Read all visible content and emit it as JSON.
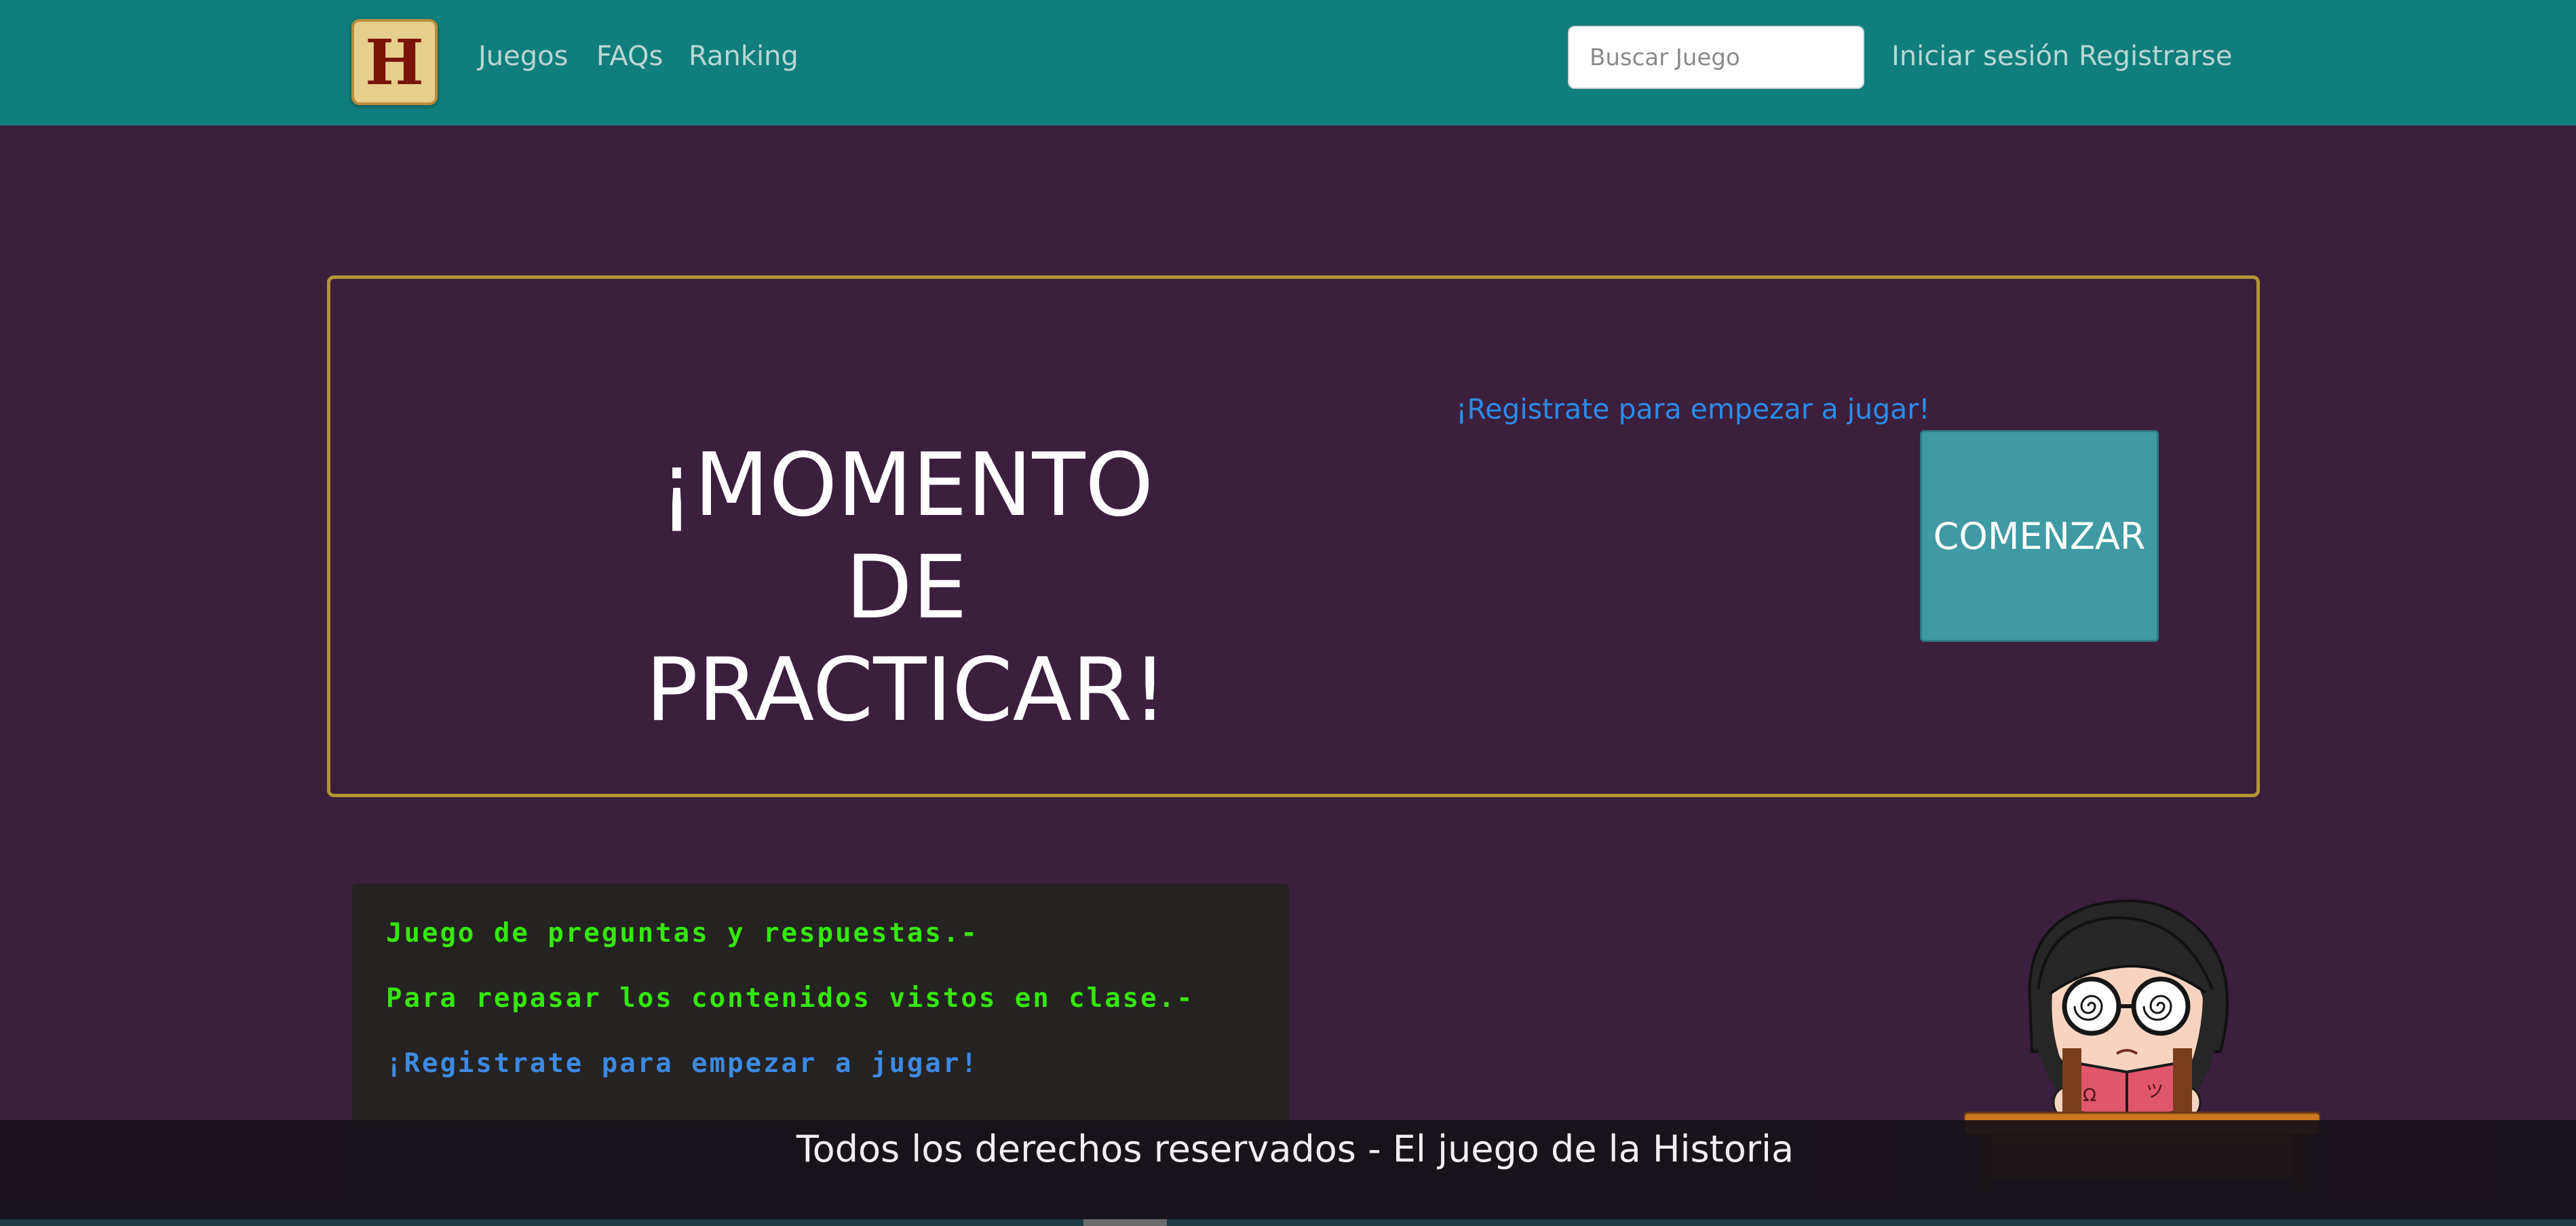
{
  "nav": {
    "logo_letter": "H",
    "links": [
      "Juegos",
      "FAQs",
      "Ranking"
    ],
    "search_placeholder": "Buscar Juego",
    "login": "Iniciar sesión",
    "register": "Registrarse"
  },
  "hero": {
    "title_line1": "¡MOMENTO DE",
    "title_line2": "PRACTICAR!",
    "register_prompt": "¡Registrate para empezar a jugar!",
    "start_button": "COMENZAR"
  },
  "info": {
    "line1": "Juego de preguntas y respuestas.-",
    "line2": "Para repasar los contenidos vistos en clase.-",
    "line3": "¡Registrate para empezar a jugar!"
  },
  "footer": {
    "text": "Todos los derechos reservados - El juego de la Historia"
  },
  "colors": {
    "navbar": "#107e7d",
    "background": "#3b1f3d",
    "card_border": "#b39533",
    "start_button": "#3f9aa4",
    "link_blue": "#2b8ce8",
    "terminal_green": "#35e80b"
  }
}
